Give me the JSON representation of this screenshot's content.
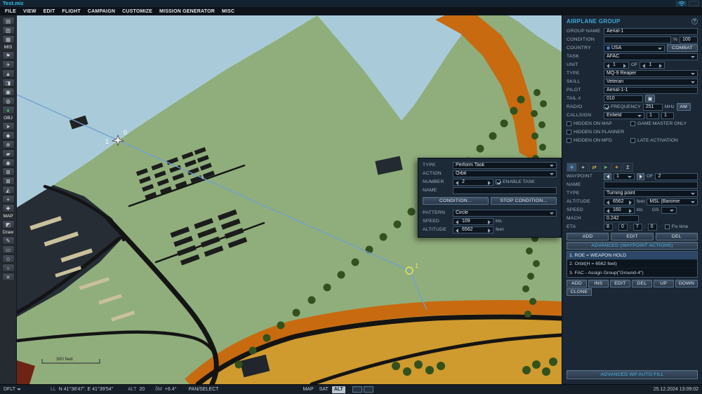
{
  "colors": {
    "accent_cyan": "#2ec3ec",
    "panel_bg": "#1b2734",
    "water": "#a9cbd9",
    "land": "#90ae7c",
    "orange_terrain": "#c86a10",
    "route_blue": "#6f9fd4",
    "waypoint_yellow": "#e8e855"
  },
  "titlebar": {
    "title": "Test.miz"
  },
  "menu": {
    "items": [
      "FILE",
      "VIEW",
      "EDIT",
      "FLIGHT",
      "CAMPAIGN",
      "CUSTOMIZE",
      "MISSION GENERATOR",
      "MISC"
    ]
  },
  "toolbar": {
    "labels": {
      "mis": "MIS",
      "obj": "OBJ",
      "map": "MAP",
      "draw": "Draw"
    },
    "icons": [
      "▤",
      "▥",
      "▦",
      "⚑",
      "✈",
      "▲",
      "◨",
      "▣",
      "◍",
      "●",
      "➤",
      "◆",
      "⊕",
      "▰",
      "◉",
      "⊞",
      "⊠",
      "◭",
      "⌖",
      "✚",
      "◩",
      "✎",
      "▭",
      "◇",
      "○",
      "✕"
    ]
  },
  "map": {
    "scale_label": "300 feet",
    "aircraft_num": "1",
    "aircraft_alt": "0",
    "waypoint_num": "1"
  },
  "dialog": {
    "type_label": "TYPE",
    "type_value": "Perform Task",
    "action_label": "ACTION",
    "action_value": "Orbit",
    "number_label": "NUMBER",
    "number_value": "2",
    "enable_task": "ENABLE TASK",
    "name_label": "NAME",
    "name_value": "",
    "condition_btn": "CONDITION...",
    "stop_condition_btn": "STOP CONDITION...",
    "pattern_label": "PATTERN",
    "pattern_value": "Circle",
    "speed_label": "SPEED",
    "speed_value": "109",
    "speed_unit": "kts",
    "altitude_label": "ALTITUDE",
    "altitude_value": "6562",
    "altitude_unit": "feet"
  },
  "group": {
    "title": "AIRPLANE GROUP",
    "help": "?",
    "name_label": "GROUP NAME",
    "name_value": "Aerial-1",
    "condition_label": "CONDITION",
    "condition_value": "",
    "percent": "%",
    "condition_num": "100",
    "country_label": "COUNTRY",
    "country_value": "USA",
    "combat_btn": "COMBAT",
    "task_label": "TASK",
    "task_value": "AFAC",
    "unit_label": "UNIT",
    "unit_value": "1",
    "of_label": "OF",
    "unit_total": "1",
    "type_label": "TYPE",
    "type_value": "MQ-9 Reaper",
    "skill_label": "SKILL",
    "skill_value": "Veteran",
    "pilot_label": "PILOT",
    "pilot_value": "Aerial-1-1",
    "tail_label": "TAIL #",
    "tail_value": "010",
    "copy_icon": "▣",
    "radio_label": "RADIO",
    "frequency_label": "FREQUENCY",
    "frequency_value": "251",
    "frequency_unit": "MHz",
    "modulation": "AM",
    "callsign_label": "CALLSIGN",
    "callsign_value": "Enfield",
    "callsign_n1": "1",
    "callsign_n2": "1",
    "hidden_map": "HIDDEN ON MAP",
    "game_master": "GAME MASTER ONLY",
    "hidden_planner": "HIDDEN ON PLANNER",
    "hidden_mfd": "HIDDEN ON MFD",
    "late_activation": "LATE ACTIVATION"
  },
  "waypoint": {
    "tabs": [
      "✈",
      "⌖",
      "⇄",
      "➤",
      "✦",
      "Σ"
    ],
    "label": "WAYPOINT",
    "number": "1",
    "of_label": "OF",
    "total": "2",
    "name_label": "NAME",
    "name_value": "",
    "type_label": "TYPE",
    "type_value": "Turning point",
    "altitude_label": "ALTITUDE",
    "altitude_value": "6562",
    "altitude_unit": "feet",
    "altitude_ref": "MSL (Barome",
    "speed_label": "SPEED",
    "speed_value": "160",
    "speed_unit": "kts",
    "speed_ref": "GS",
    "mach_label": "MACH",
    "mach_value": "0.242",
    "eta_label": "ETA",
    "eta_d": "8",
    "eta_h": "0",
    "eta_m": "7",
    "eta_s": "0",
    "eta_sep": ":",
    "fix_time": "Fix time",
    "add_btn": "ADD",
    "edit_btn": "EDIT",
    "del_btn": "DEL",
    "advanced_btn": "ADVANCED (WAYPOINT ACTIONS)",
    "actions": [
      "1. ROE = WEAPON HOLD",
      "2. Orbit(H = 6562 feet)",
      "3. FAC - Assign Group(\"Ground-4\")"
    ],
    "action_btns": [
      "ADD",
      "INS",
      "EDIT",
      "DEL",
      "UP",
      "DOWN"
    ],
    "clone_btn": "CLONE",
    "autofill_btn": "ADVANCED WP AUTO FILL"
  },
  "status": {
    "layer": "DFLT",
    "ll": "LL",
    "coords": "N 41°38'47\". E 41°39'54\"",
    "alt_label": "ALT",
    "alt_value": "20",
    "dm_label": "δM",
    "dm_value": "+6.4°",
    "mode": "PAN/SELECT",
    "map_btn": "MAP",
    "sat_btn": "SAT",
    "alt_btn": "ALT",
    "datetime": "25.12.2024 13:09:02"
  }
}
